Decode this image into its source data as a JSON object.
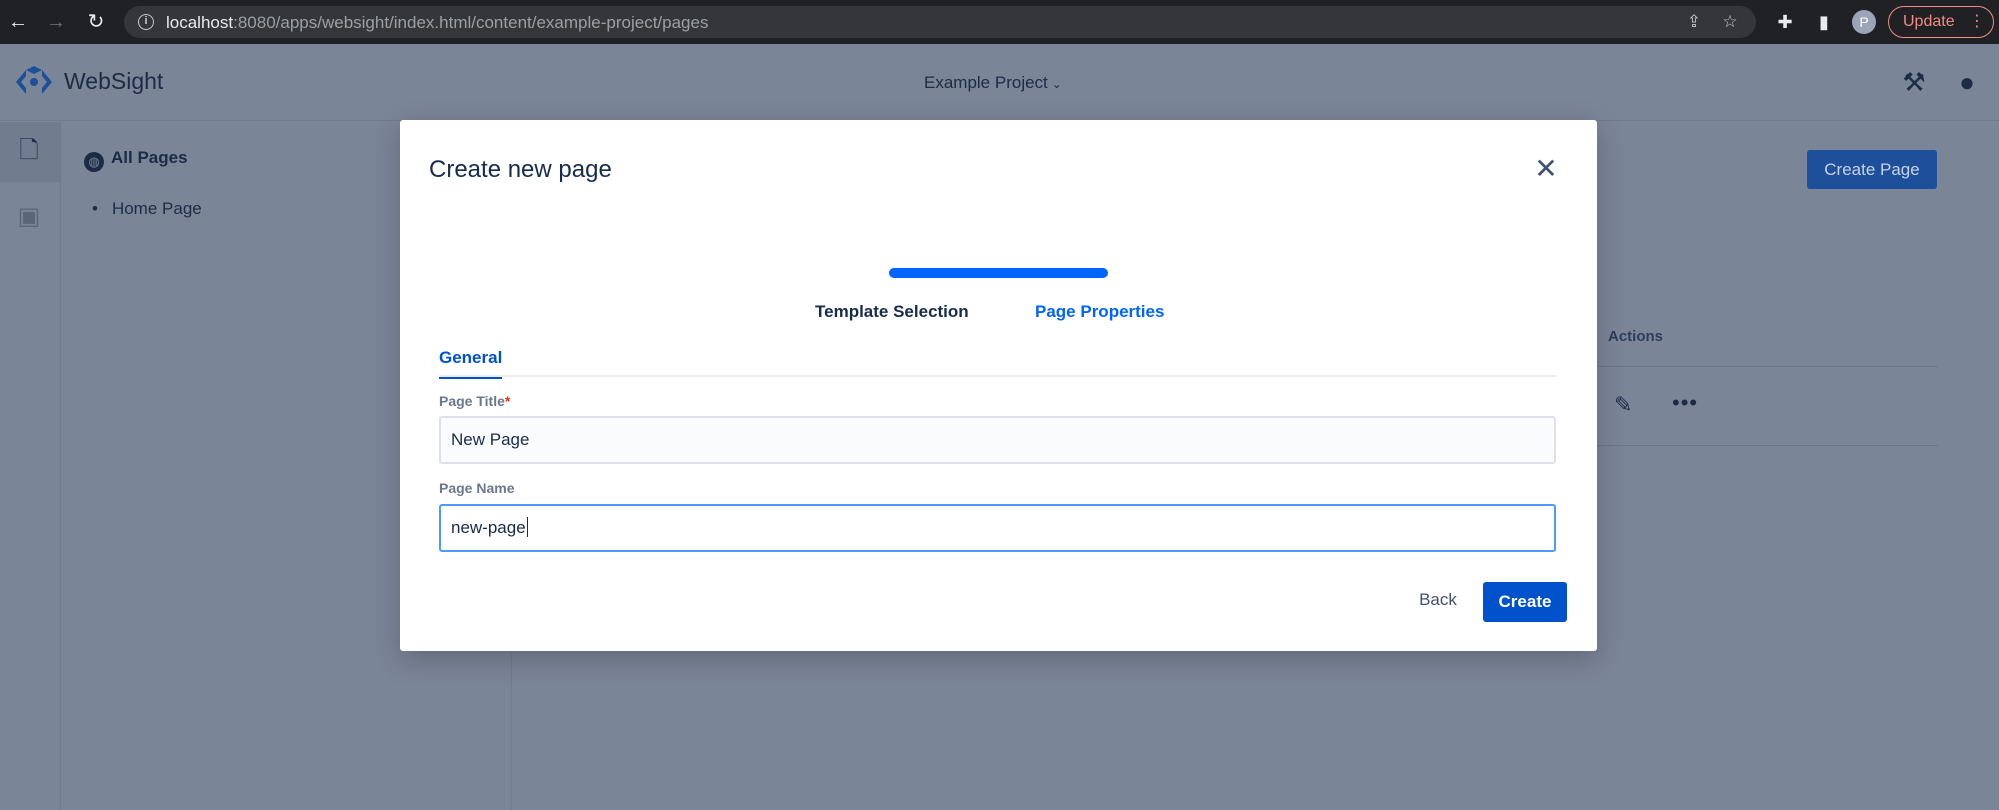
{
  "browser": {
    "url_host": "localhost",
    "url_path": ":8080/apps/websight/index.html/content/example-project/pages",
    "profile_initial": "P",
    "update_label": "Update"
  },
  "app": {
    "brand": "WebSight",
    "project_name": "Example Project"
  },
  "sidebar": {
    "title": "All Pages",
    "items": [
      {
        "label": "Home Page"
      }
    ]
  },
  "background": {
    "create_page_label": "Create Page",
    "actions_header": "Actions"
  },
  "modal": {
    "title": "Create new page",
    "progress_fraction": 1.0,
    "steps": [
      {
        "label": "Template Selection",
        "state": "completed"
      },
      {
        "label": "Page Properties",
        "state": "active"
      }
    ],
    "tab_label": "General",
    "page_title": {
      "label": "Page Title",
      "required_marker": "*",
      "value": "New Page"
    },
    "page_name": {
      "label": "Page Name",
      "value": "new-page"
    },
    "back_label": "Back",
    "create_label": "Create"
  },
  "colors": {
    "accent": "#0052cc",
    "progress": "#0065ff",
    "overlay": "#7b8598"
  }
}
